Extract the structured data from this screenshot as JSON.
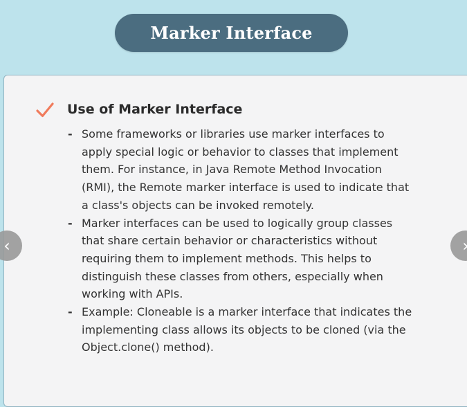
{
  "slide": {
    "title": "Marker Interface",
    "section_heading": "Use of Marker Interface",
    "bullets": [
      "Some frameworks or libraries use marker interfaces to apply special logic or behavior to classes that implement them. For instance, in Java Remote Method Invocation (RMI), the Remote marker interface is used to indicate that a class's objects can be invoked remotely.",
      "Marker interfaces can be used to logically group classes that share certain behavior or characteristics without requiring them to implement methods. This helps to distinguish these classes from others, especially when working with APIs.",
      "Example: Cloneable is a marker interface that indicates the implementing class allows its objects to be cloned (via the Object.clone() method)."
    ],
    "bullet_marker": "-"
  },
  "navigation": {
    "prev_glyph": "‹",
    "next_glyph": "›"
  },
  "icons": {
    "heading_icon": "checkmark-icon",
    "prev_icon": "chevron-left-icon",
    "next_icon": "chevron-right-icon"
  },
  "colors": {
    "background": "#bde3ec",
    "title_pill": "#4b6d80",
    "card": "#f4f4f5",
    "checkmark": "#f07b5c",
    "nav_button": "#9a9a9a"
  }
}
